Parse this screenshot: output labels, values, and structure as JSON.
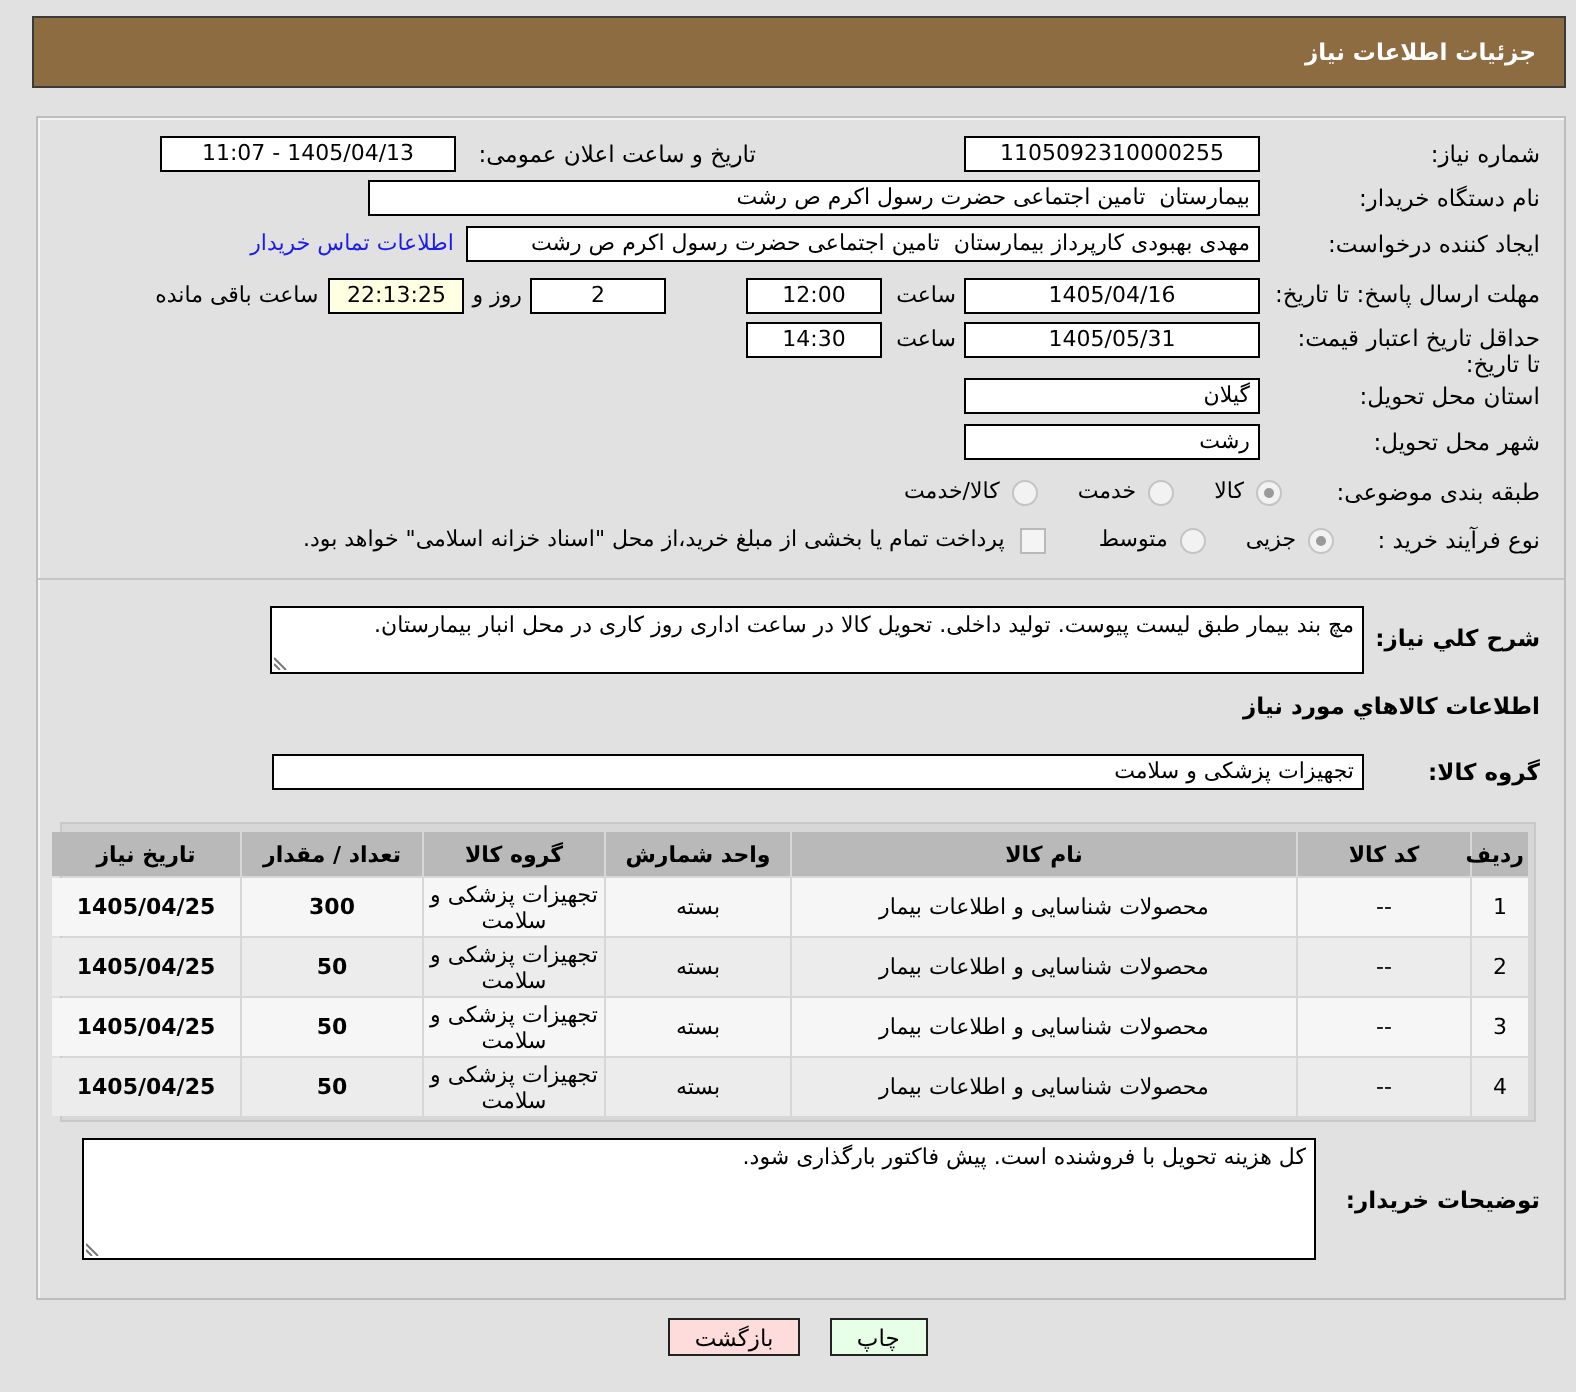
{
  "header": {
    "title": "جزئیات اطلاعات نیاز"
  },
  "details": {
    "need_number": {
      "label": "شماره نیاز:",
      "value": "1105092310000255"
    },
    "announce_datetime": {
      "label": "تاریخ و ساعت اعلان عمومی:",
      "value": "1405/04/13 - 11:07"
    },
    "buyer_org": {
      "label": "نام دستگاه خریدار:",
      "value": "بیمارستان  تامین اجتماعی حضرت رسول اکرم ص رشت"
    },
    "requester": {
      "label": "ایجاد کننده درخواست:",
      "value": "مهدی بهبودی کارپرداز بیمارستان  تامین اجتماعی حضرت رسول اکرم ص رشت",
      "contact_link": "اطلاعات تماس خریدار"
    },
    "response_deadline": {
      "label": "مهلت ارسال پاسخ: تا تاریخ:",
      "date": "1405/04/16",
      "time_label": "ساعت",
      "time": "12:00",
      "days": "2",
      "days_label": "روز و",
      "remaining": "22:13:25",
      "remaining_label": "ساعت باقی مانده"
    },
    "price_validity": {
      "label": "حداقل تاریخ اعتبار قیمت: تا تاریخ:",
      "date": "1405/05/31",
      "time_label": "ساعت",
      "time": "14:30"
    },
    "delivery_province": {
      "label": "استان محل تحویل:",
      "value": "گیلان"
    },
    "delivery_city": {
      "label": "شهر محل تحویل:",
      "value": "رشت"
    },
    "subject_category": {
      "label": "طبقه بندی موضوعی:",
      "options": [
        {
          "label": "کالا",
          "selected": true
        },
        {
          "label": "خدمت",
          "selected": false
        },
        {
          "label": "کالا/خدمت",
          "selected": false
        }
      ]
    },
    "purchase_process": {
      "label": "نوع فرآیند خرید :",
      "options": [
        {
          "label": "جزیی",
          "selected": true
        },
        {
          "label": "متوسط",
          "selected": false
        }
      ],
      "treasury_payment": {
        "label": "پرداخت تمام یا بخشی از مبلغ خرید،از محل \"اسناد خزانه اسلامی\" خواهد بود.",
        "checked": false
      }
    }
  },
  "description": {
    "label": "شرح کلي نیاز:",
    "value": "مچ بند بیمار طبق لیست پیوست. تولید داخلی. تحویل کالا در ساعت اداری روز کاری در محل انبار بیمارستان."
  },
  "goods_section": {
    "title": "اطلاعات کالاهاي مورد نیاز",
    "group_label": "گروه کالا:",
    "group_value": "تجهیزات پزشکی و سلامت"
  },
  "table": {
    "columns": [
      "ردیف",
      "کد کالا",
      "نام کالا",
      "واحد شمارش",
      "گروه کالا",
      "تعداد / مقدار",
      "تاریخ نیاز"
    ],
    "rows": [
      [
        "1",
        "--",
        "محصولات شناسایی و اطلاعات بیمار",
        "بسته",
        "تجهیزات پزشکی و سلامت",
        "300",
        "1405/04/25"
      ],
      [
        "2",
        "--",
        "محصولات شناسایی و اطلاعات بیمار",
        "بسته",
        "تجهیزات پزشکی و سلامت",
        "50",
        "1405/04/25"
      ],
      [
        "3",
        "--",
        "محصولات شناسایی و اطلاعات بیمار",
        "بسته",
        "تجهیزات پزشکی و سلامت",
        "50",
        "1405/04/25"
      ],
      [
        "4",
        "--",
        "محصولات شناسایی و اطلاعات بیمار",
        "بسته",
        "تجهیزات پزشکی و سلامت",
        "50",
        "1405/04/25"
      ]
    ]
  },
  "buyer_notes": {
    "label": "توضیحات خریدار:",
    "value": "کل هزینه تحویل با فروشنده است. پیش فاکتور بارگذاری شود."
  },
  "buttons": [
    {
      "label": "چاپ",
      "kind": "print"
    },
    {
      "label": "بازگشت",
      "kind": "back"
    }
  ]
}
